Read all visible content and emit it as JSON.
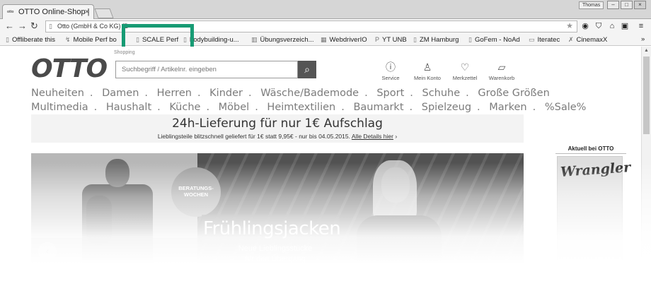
{
  "browser": {
    "tab_title": "OTTO Online-Shop |",
    "tab_favicon": "otto",
    "tab_close": "×",
    "user_badge": "Thomas",
    "url": "Otto (GmbH & Co KG) [D",
    "bookmarks": [
      {
        "label": "Offliberate this",
        "icon": "page-icon"
      },
      {
        "label": "Mobile Perf bo",
        "icon": "bolt-icon"
      },
      {
        "label": "SCALE Perf",
        "icon": "page-icon"
      },
      {
        "label": "bodybuilding-u...",
        "icon": "page-icon"
      },
      {
        "label": "Übungsverzeich...",
        "icon": "grid-icon"
      },
      {
        "label": "WebdriverIO",
        "icon": "webdriver-icon"
      },
      {
        "label": "YT UNB",
        "icon": "p-icon"
      },
      {
        "label": "ZM Hamburg",
        "icon": "page-icon"
      },
      {
        "label": "GoFem - NoAd",
        "icon": "page-icon"
      },
      {
        "label": "Iteratec",
        "icon": "folder-icon"
      },
      {
        "label": "CinemaxX",
        "icon": "pin-icon"
      }
    ],
    "bookmarks_overflow": "»"
  },
  "header": {
    "logo": "OTTO",
    "shop_label": "Shopping",
    "search_placeholder": "Suchbegriff / Artikelnr. eingeben",
    "service_links": [
      {
        "label": "Service",
        "icon": "info-icon"
      },
      {
        "label": "Mein Konto",
        "icon": "user-icon"
      },
      {
        "label": "Merkzettel",
        "icon": "heart-icon"
      },
      {
        "label": "Warenkorb",
        "icon": "cart-icon"
      }
    ]
  },
  "nav": {
    "row1": [
      "Neuheiten",
      "Damen",
      "Herren",
      "Kinder",
      "Wäsche/Bademode",
      "Sport",
      "Schuhe",
      "Große Größen"
    ],
    "row2": [
      "Multimedia",
      "Haushalt",
      "Küche",
      "Möbel",
      "Heimtextilien",
      "Baumarkt",
      "Spielzeug",
      "Marken",
      "%Sale%"
    ]
  },
  "promo": {
    "title": "24h-Lieferung für nur 1€ Aufschlag",
    "subtitle": "Lieblingsteile blitzschnell geliefert für 1€ statt 9,95€ - nur bis 04.05.2015.",
    "link": "Alle Details hier",
    "link_arrow": "›"
  },
  "hero": {
    "badge_line1": "BERATUNGS-",
    "badge_line2": "WOCHEN",
    "headline": "Frühlingsjacken",
    "subline1": "Neue Lieblingsstücke",
    "subline2": "für den Übergang",
    "prev": "‹"
  },
  "sidebar": {
    "title": "Aktuell bei OTTO",
    "brand": "Wrangler"
  }
}
